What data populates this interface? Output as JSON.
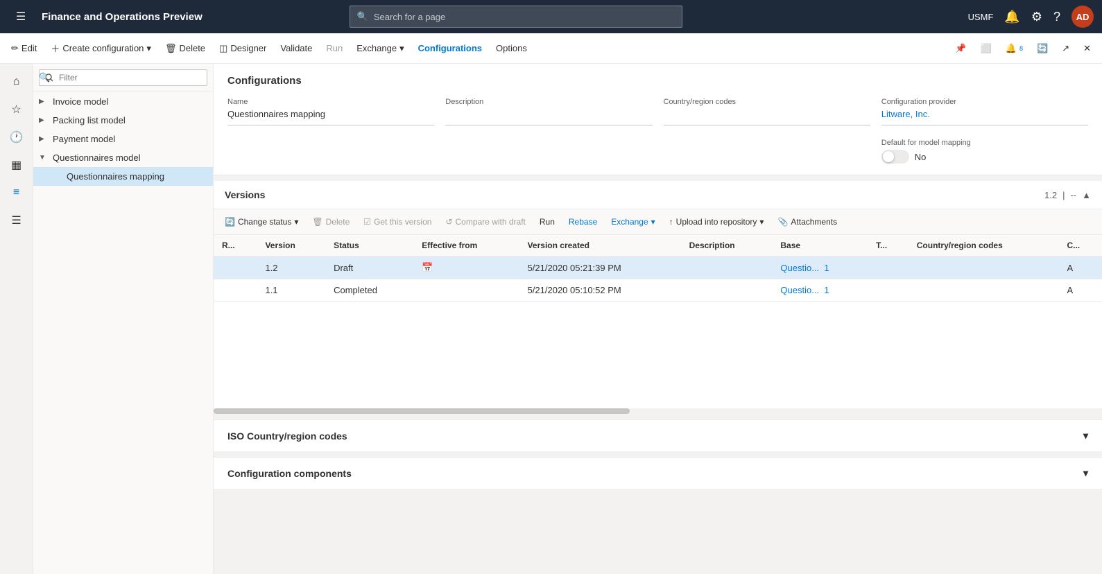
{
  "app": {
    "title": "Finance and Operations Preview",
    "search_placeholder": "Search for a page"
  },
  "top_nav": {
    "user": "USMF",
    "user_initials": "AD"
  },
  "command_bar": {
    "edit": "Edit",
    "create_config": "Create configuration",
    "delete": "Delete",
    "designer": "Designer",
    "validate": "Validate",
    "run": "Run",
    "exchange": "Exchange",
    "configurations": "Configurations",
    "options": "Options"
  },
  "tree": {
    "filter_placeholder": "Filter",
    "items": [
      {
        "label": "Invoice model",
        "indent": 0,
        "has_children": true
      },
      {
        "label": "Packing list model",
        "indent": 0,
        "has_children": true
      },
      {
        "label": "Payment model",
        "indent": 0,
        "has_children": true
      },
      {
        "label": "Questionnaires model",
        "indent": 0,
        "has_children": true,
        "expanded": true
      },
      {
        "label": "Questionnaires mapping",
        "indent": 1,
        "has_children": false,
        "active": true
      }
    ]
  },
  "configurations": {
    "section_title": "Configurations",
    "name_label": "Name",
    "name_value": "Questionnaires mapping",
    "description_label": "Description",
    "description_value": "",
    "country_label": "Country/region codes",
    "country_value": "",
    "provider_label": "Configuration provider",
    "provider_value": "Litware, Inc.",
    "default_mapping_label": "Default for model mapping",
    "default_mapping_value": "No"
  },
  "versions": {
    "section_title": "Versions",
    "version_number": "1.2",
    "toolbar": {
      "change_status": "Change status",
      "delete": "Delete",
      "get_this_version": "Get this version",
      "compare_with_draft": "Compare with draft",
      "run": "Run",
      "rebase": "Rebase",
      "exchange": "Exchange",
      "upload_into_repository": "Upload into repository",
      "attachments": "Attachments"
    },
    "table": {
      "columns": [
        "R...",
        "Version",
        "Status",
        "Effective from",
        "Version created",
        "Description",
        "Base",
        "T...",
        "Country/region codes",
        "C..."
      ],
      "rows": [
        {
          "r": "",
          "version": "1.2",
          "status": "Draft",
          "effective_from": "",
          "version_created": "5/21/2020 05:21:39 PM",
          "description": "",
          "base": "Questio...",
          "base_link": "1",
          "t": "",
          "country": "",
          "c": "A",
          "selected": true
        },
        {
          "r": "",
          "version": "1.1",
          "status": "Completed",
          "effective_from": "",
          "version_created": "5/21/2020 05:10:52 PM",
          "description": "",
          "base": "Questio...",
          "base_link": "1",
          "t": "",
          "country": "",
          "c": "A",
          "selected": false
        }
      ]
    }
  },
  "iso_section": {
    "title": "ISO Country/region codes"
  },
  "config_components_section": {
    "title": "Configuration components"
  }
}
